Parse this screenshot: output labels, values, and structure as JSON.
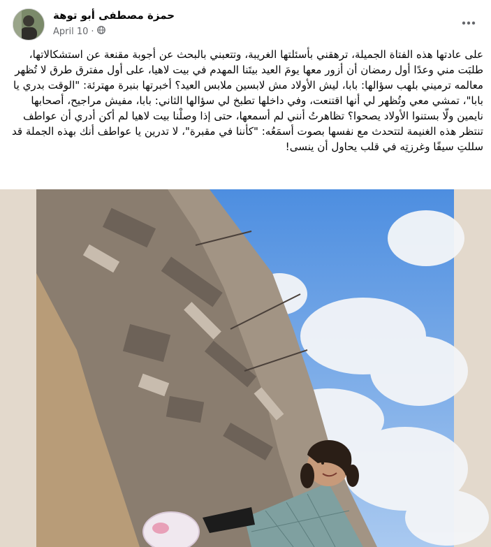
{
  "post": {
    "author": "حمزة مصطفى أبو توهة",
    "date": "April 10",
    "separator": "·",
    "audience_icon": "globe-icon",
    "more_icon": "ellipsis-icon",
    "text": "على عادتها هذه الفتاة الجميلة، ترهقني بأسئلتها الغريبة، وتتعبني بالبحث عن أجوبة مقنعة عن استشكالاتها، طلبَت مني وعدًا أول رمضان أن أزور معها يومَ العيد بيتَنا المهدم في بيت لاهيا، على أول مفترق طرق لا تُظهر معالمه ترميني بلهب سؤالها: بابا، ليش الأولاد مش لابسين ملابس العيد؟ أخبرتها بنبرة مهترئة: \"الوقت بدري يا بابا\"، تمشي معي وتُظهر لي أنها اقتنعت، وفي داخلها تطبخ لي سؤالها الثاني: بابا، مفيش مراجيح، أصحابها نايمين ولّا بستنوا الأولاد يصحوا؟ تظاهرتُ أنني لم أسمعها، حتى إذا وصلْنا بيت لاهيا لم أكن أدري أن عواطف تنتظر هذه الغنيمة لتتحدث مع نفسها بصوت أسمَعُه: \"كأننا في مقبرة\"، لا تدرين يا عواطف أنك بهذه الجملة قد سللتِ سيفًا وغرزتِه في قلب يحاول أن ينسى!"
  },
  "photo": {
    "subject": "girl-standing-in-front-of-destroyed-building"
  }
}
